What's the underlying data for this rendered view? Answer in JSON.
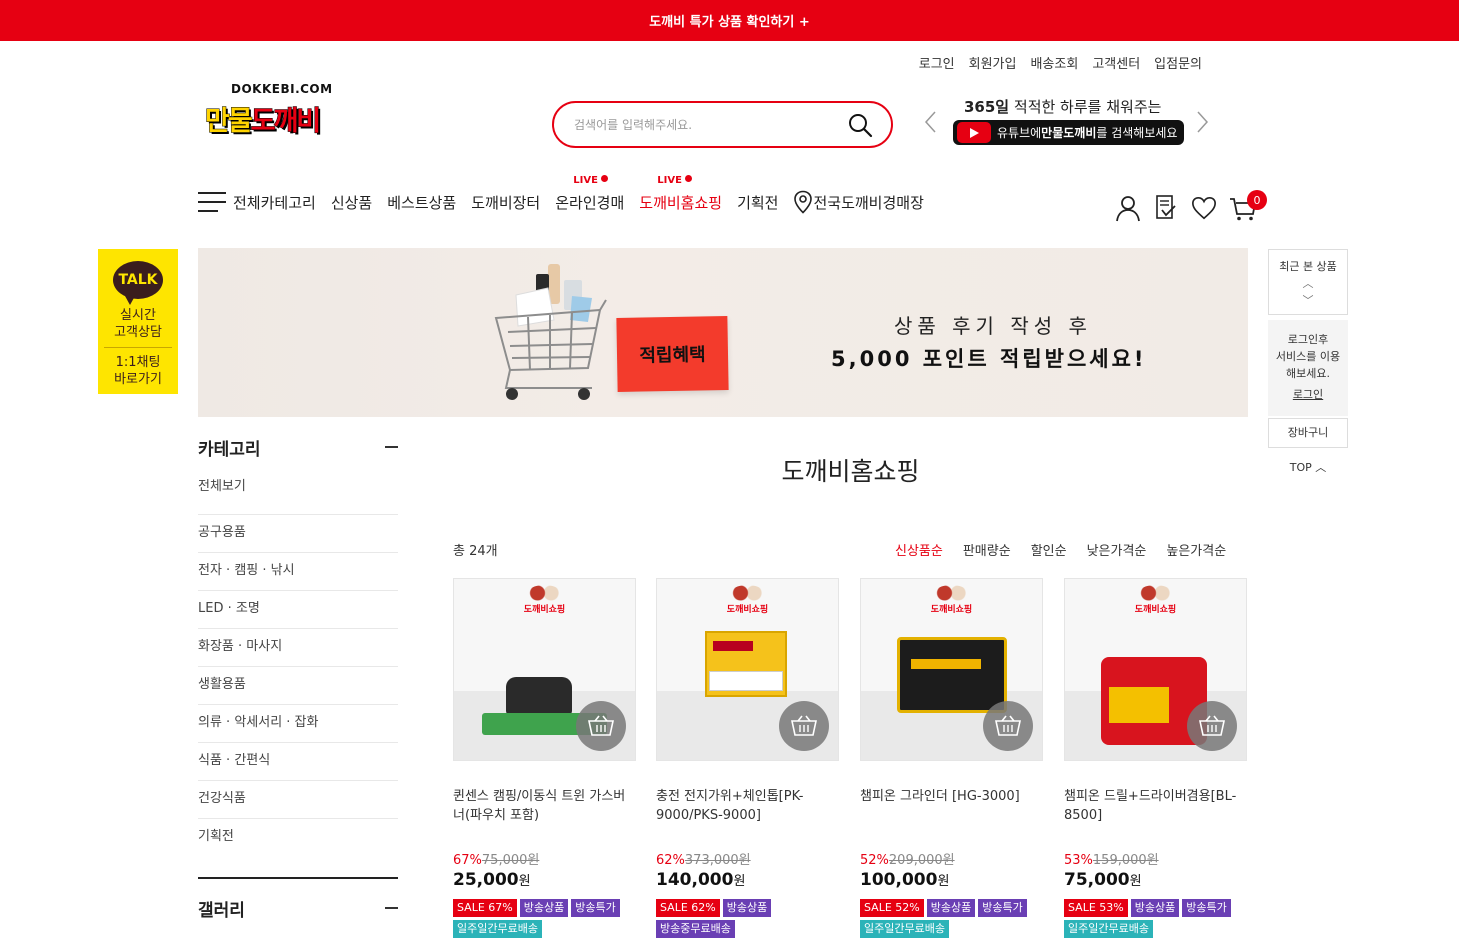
{
  "top_banner": "도깨비 특가 상품 확인하기 +",
  "util_links": [
    "로그인",
    "회원가입",
    "배송조회",
    "고객센터",
    "입점문의"
  ],
  "logo": {
    "domain": "DOKKEBI.COM",
    "part1": "만물",
    "part2": "도깨비"
  },
  "search": {
    "placeholder": "검색어를 입력해주세요."
  },
  "promo": {
    "line1_bold": "365일",
    "line1_rest": " 적적한 하루를 채워주는",
    "yt_pre": "유튜브에 ",
    "yt_bold": "만물도깨비",
    "yt_post": "를 검색해보세요"
  },
  "nav": {
    "all_categories": "전체카테고리",
    "items": [
      "신상품",
      "베스트상품",
      "도깨비장터",
      "온라인경매",
      "도깨비홈쇼핑",
      "기획전"
    ],
    "live_label": "LIVE",
    "store": "전국도깨비경매장",
    "cart_count": "0"
  },
  "kakao": {
    "talk": "TALK",
    "line1": "실시간",
    "line2": "고객상담",
    "line3": "1:1채팅",
    "line4": "바로가기"
  },
  "hero": {
    "tag": "적립혜택",
    "line1": "상품 후기 작성 후",
    "line2": "5,000 포인트 적립받으세요!"
  },
  "quick": {
    "recent": "최근 본 상품",
    "login_msg1": "로그인후",
    "login_msg2": "서비스를 이용",
    "login_msg3": "해보세요.",
    "login_link": "로그인",
    "cart": "장바구니",
    "top": "TOP"
  },
  "category": {
    "title": "카테고리",
    "items": [
      "전체보기",
      "공구용품",
      "전자 · 캠핑 · 낚시",
      "LED · 조명",
      "화장품 · 마사지",
      "생활용품",
      "의류 · 악세서리 · 잡화",
      "식품 · 간편식",
      "건강식품",
      "기획전"
    ],
    "gallery": "갤러리"
  },
  "main": {
    "title": "도깨비홈쇼핑",
    "total": "총 24개",
    "sort": [
      "신상품순",
      "판매량순",
      "할인순",
      "낮은가격순",
      "높은가격순"
    ]
  },
  "products": [
    {
      "brand": "도깨비쇼핑",
      "name": "퀸센스 캠핑/이동식 트윈 가스버너(파우치 포함)",
      "rate": "67%",
      "orig": "75,000원",
      "price": "25,000",
      "won": "원",
      "badges": [
        "SALE 67%",
        "방송상품",
        "방송특가",
        "일주일간무료배송"
      ]
    },
    {
      "brand": "도깨비쇼핑",
      "name": "충전 전지가위+체인톱[PK-9000/PKS-9000]",
      "rate": "62%",
      "orig": "373,000원",
      "price": "140,000",
      "won": "원",
      "badges": [
        "SALE 62%",
        "방송상품",
        "방송중무료배송"
      ]
    },
    {
      "brand": "도깨비쇼핑",
      "name": "챔피온 그라인더 [HG-3000]",
      "rate": "52%",
      "orig": "209,000원",
      "price": "100,000",
      "won": "원",
      "badges": [
        "SALE 52%",
        "방송상품",
        "방송특가",
        "일주일간무료배송"
      ]
    },
    {
      "brand": "도깨비쇼핑",
      "name": "챔피온 드릴+드라이버겸용[BL-8500]",
      "rate": "53%",
      "orig": "159,000원",
      "price": "75,000",
      "won": "원",
      "badges": [
        "SALE 53%",
        "방송상품",
        "방송특가",
        "일주일간무료배송"
      ]
    }
  ],
  "colors": {
    "brand_red": "#e60012",
    "kakao_yellow": "#fee500",
    "badge_purple": "#6a3fb4",
    "badge_teal": "#2bb3b8"
  }
}
